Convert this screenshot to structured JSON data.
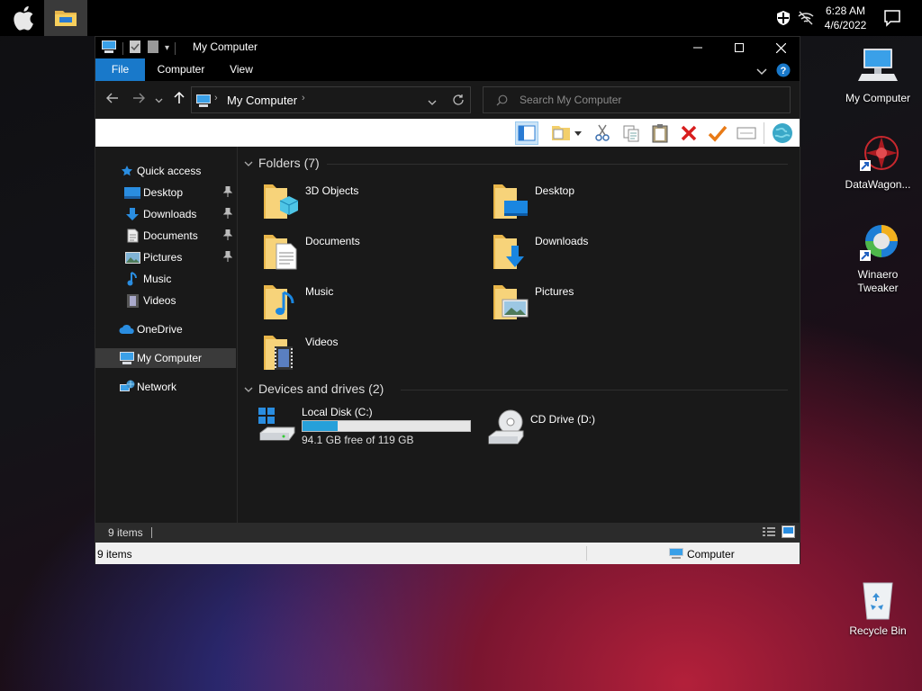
{
  "taskbar": {
    "clock_time": "6:28 AM",
    "clock_date": "4/6/2022"
  },
  "desktop": {
    "icons": [
      {
        "label": "My Computer"
      },
      {
        "label": "DataWagon..."
      },
      {
        "label": "Winaero Tweaker"
      },
      {
        "label": "Recycle Bin"
      }
    ]
  },
  "window": {
    "title": "My Computer",
    "tabs": [
      {
        "label": "File"
      },
      {
        "label": "Computer"
      },
      {
        "label": "View"
      }
    ],
    "address": "My Computer",
    "search_placeholder": "Search My Computer",
    "folders_header": "Folders (7)",
    "folders": [
      {
        "label": "3D Objects"
      },
      {
        "label": "Desktop"
      },
      {
        "label": "Documents"
      },
      {
        "label": "Downloads"
      },
      {
        "label": "Music"
      },
      {
        "label": "Pictures"
      },
      {
        "label": "Videos"
      }
    ],
    "drives_header": "Devices and drives (2)",
    "drives": [
      {
        "label": "Local Disk (C:)",
        "free_text": "94.1 GB free of 119 GB",
        "used_fraction": 0.21
      },
      {
        "label": "CD Drive (D:)"
      }
    ],
    "nav": {
      "quick_access": "Quick access",
      "items": [
        {
          "label": "Desktop"
        },
        {
          "label": "Downloads"
        },
        {
          "label": "Documents"
        },
        {
          "label": "Pictures"
        },
        {
          "label": "Music"
        },
        {
          "label": "Videos"
        }
      ],
      "onedrive": "OneDrive",
      "my_computer": "My Computer",
      "network": "Network"
    },
    "status_items": "9 items",
    "status2_items": "9 items",
    "status2_zone": "Computer"
  },
  "colors": {
    "accent": "#1979ca",
    "drive_bar": "#26a0da"
  }
}
